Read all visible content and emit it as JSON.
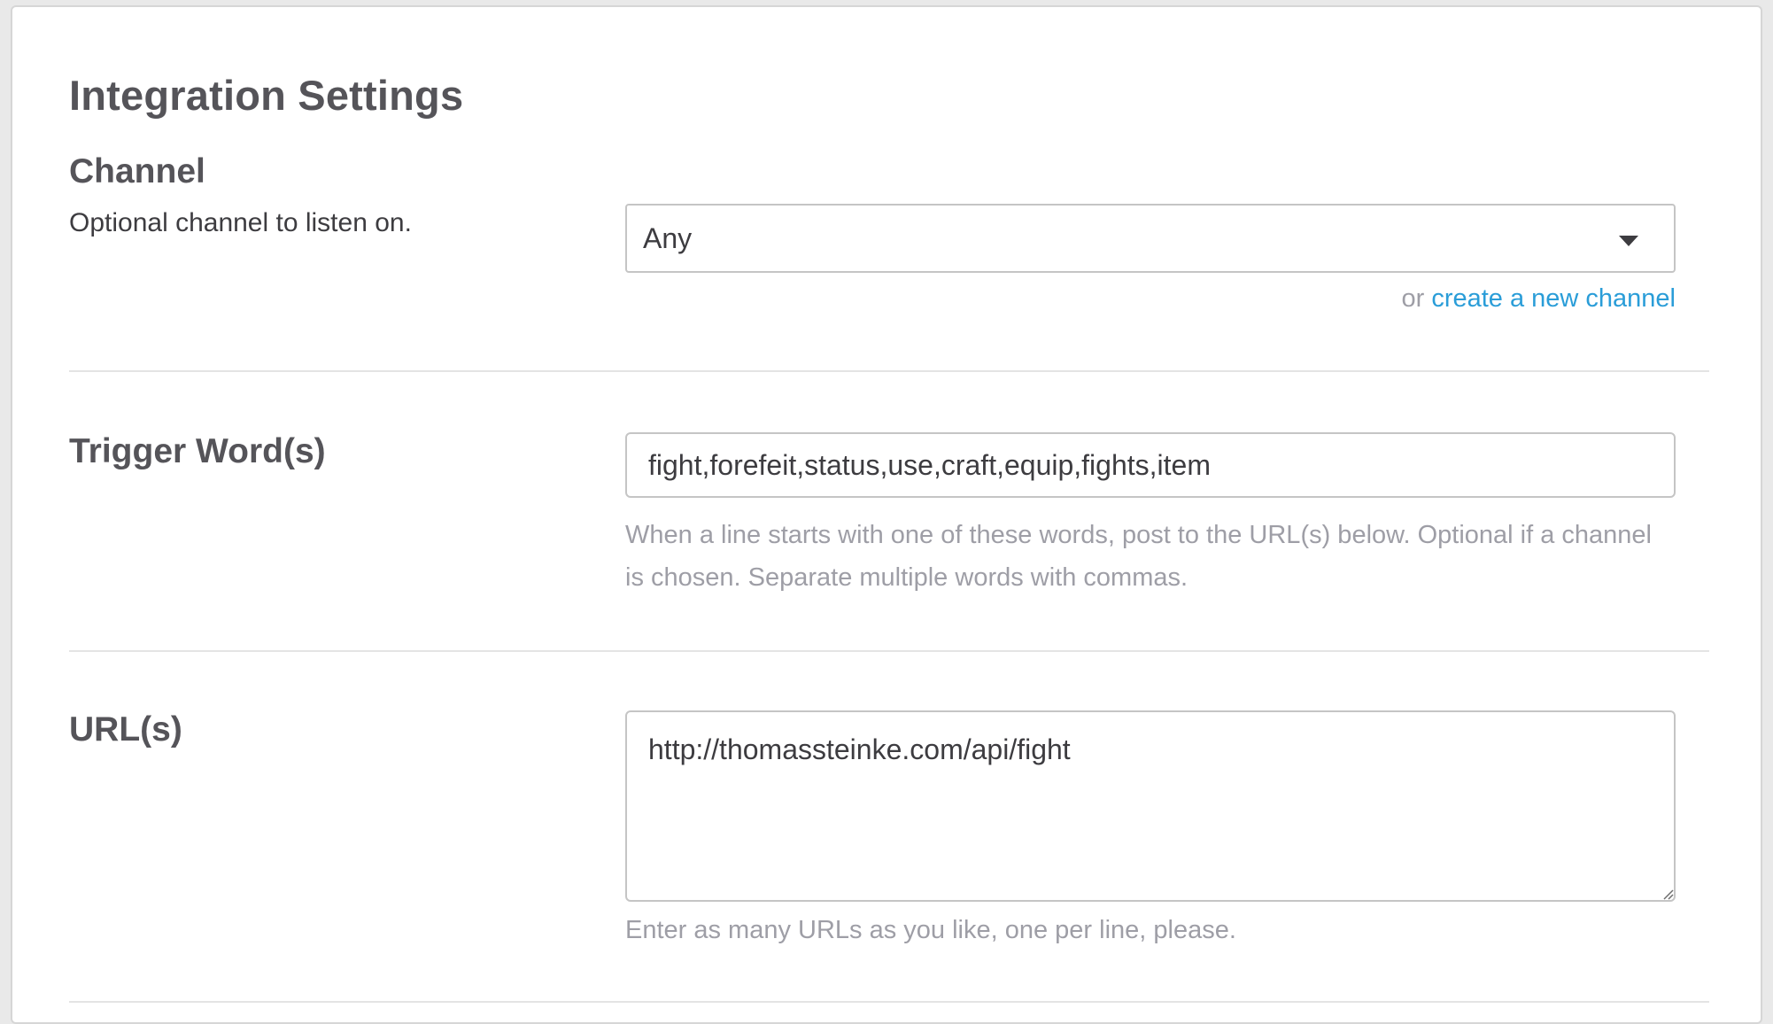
{
  "page": {
    "title": "Integration Settings"
  },
  "channel": {
    "label": "Channel",
    "description": "Optional channel to listen on.",
    "selected": "Any",
    "helper_prefix": "or",
    "create_link": "create a new channel",
    "caret_icon": "chevron-down-icon"
  },
  "trigger": {
    "label": "Trigger Word(s)",
    "value": "fight,forefeit,status,use,craft,equip,fights,item",
    "helper": "When a line starts with one of these words, post to the URL(s) below. Optional if a channel is chosen. Separate multiple words with commas."
  },
  "urls": {
    "label": "URL(s)",
    "value": "http://thomassteinke.com/api/fight",
    "helper": "Enter as many URLs as you like, one per line, please.",
    "grip_icon": "resize-grip-icon"
  },
  "colors": {
    "link": "#2a9dd8",
    "heading": "#555459",
    "helper_text": "#9e9ea6",
    "border": "#c5c5c5"
  }
}
